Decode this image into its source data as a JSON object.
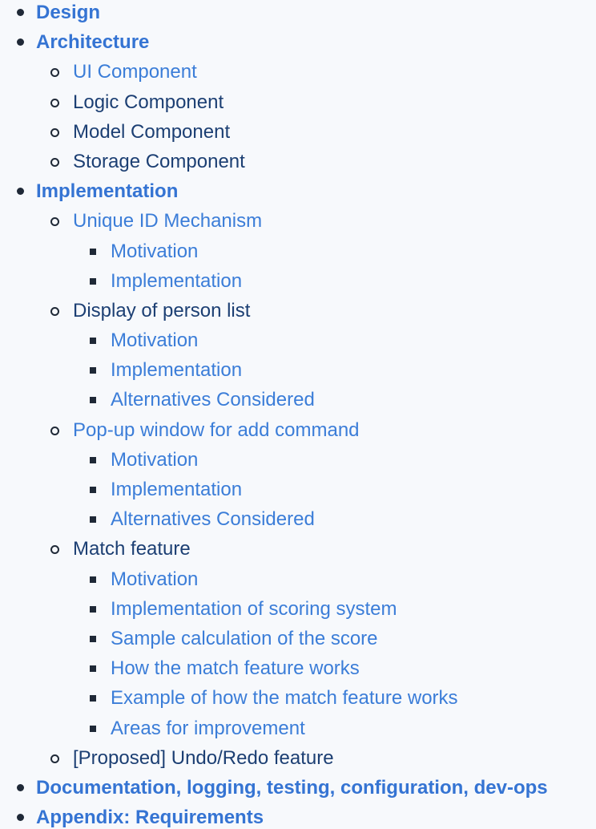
{
  "colors": {
    "link": "#3b7dd8",
    "text": "#1c3f73",
    "bullet": "#1f2937",
    "background": "#f7f9fc"
  },
  "toc": {
    "design": "Design",
    "architecture": "Architecture",
    "ui_component": "UI Component",
    "logic_component": "Logic Component",
    "model_component": "Model Component",
    "storage_component": "Storage Component",
    "implementation": "Implementation",
    "unique_id_mechanism": "Unique ID Mechanism",
    "uid_motivation": "Motivation",
    "uid_implementation": "Implementation",
    "display_person_list": "Display of person list",
    "dpl_motivation": "Motivation",
    "dpl_implementation": "Implementation",
    "dpl_alternatives": "Alternatives Considered",
    "popup_window": "Pop-up window for add command",
    "pw_motivation": "Motivation",
    "pw_implementation": "Implementation",
    "pw_alternatives": "Alternatives Considered",
    "match_feature": "Match feature",
    "mf_motivation": "Motivation",
    "mf_scoring": "Implementation of scoring system",
    "mf_sample": "Sample calculation of the score",
    "mf_how": "How the match feature works",
    "mf_example": "Example of how the match feature works",
    "mf_areas": "Areas for improvement",
    "undo_redo": "[Proposed] Undo/Redo feature",
    "documentation": "Documentation, logging, testing, configuration, dev-ops",
    "appendix": "Appendix: Requirements"
  }
}
